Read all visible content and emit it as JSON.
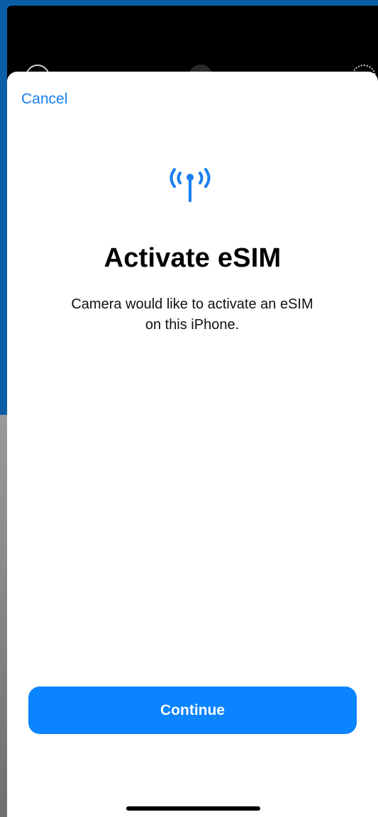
{
  "sheet": {
    "cancel_label": "Cancel",
    "icon": "antenna-radiowaves-icon",
    "title": "Activate eSIM",
    "subtitle": "Camera would like to activate an eSIM on this iPhone.",
    "continue_label": "Continue"
  },
  "colors": {
    "accent": "#0a84ff",
    "link": "#1a7ef0",
    "background": "#ffffff",
    "frame": "#0b5ea6"
  }
}
